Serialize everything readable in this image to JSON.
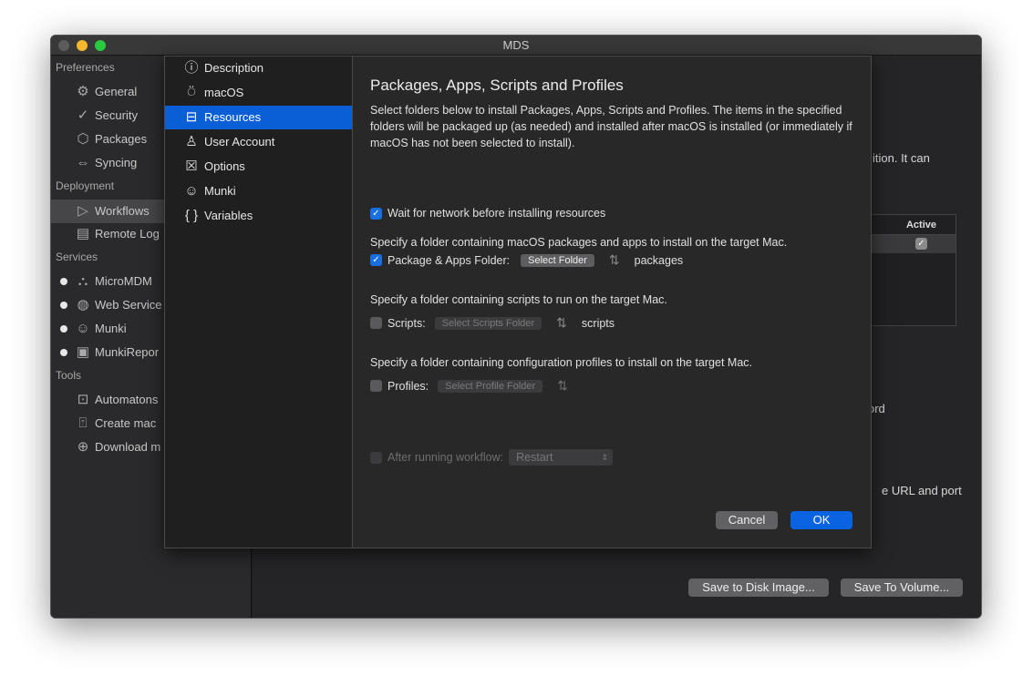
{
  "window": {
    "title": "MDS"
  },
  "sidebar": {
    "sections": [
      {
        "label": "Preferences",
        "items": [
          {
            "label": "General",
            "icon": "gear-icon"
          },
          {
            "label": "Security",
            "icon": "shield-check-icon"
          },
          {
            "label": "Packages",
            "icon": "package-icon"
          },
          {
            "label": "Syncing",
            "icon": "sync-icon"
          }
        ]
      },
      {
        "label": "Deployment",
        "items": [
          {
            "label": "Workflows",
            "icon": "play-icon",
            "selected": true
          },
          {
            "label": "Remote Log",
            "icon": "chat-icon"
          }
        ]
      },
      {
        "label": "Services",
        "items": [
          {
            "label": "MicroMDM",
            "icon": "micromdm-icon"
          },
          {
            "label": "Web Service",
            "icon": "globe-icon"
          },
          {
            "label": "Munki",
            "icon": "munki-icon"
          },
          {
            "label": "MunkiRepor",
            "icon": "munkireport-icon"
          }
        ]
      },
      {
        "label": "Tools",
        "items": [
          {
            "label": "Automatons",
            "icon": "robot-icon"
          },
          {
            "label": "Create mac",
            "icon": "upload-disk-icon"
          },
          {
            "label": "Download m",
            "icon": "download-icon"
          }
        ]
      }
    ]
  },
  "background": {
    "text1": "ition. It can",
    "active_header": "Active",
    "text2": "ord",
    "text3": "e URL and port",
    "save_disk": "Save to Disk Image...",
    "save_volume": "Save To Volume..."
  },
  "sheet": {
    "nav": [
      {
        "label": "Description",
        "icon": "info-icon"
      },
      {
        "label": "macOS",
        "icon": "macos-install-icon"
      },
      {
        "label": "Resources",
        "icon": "briefcase-icon",
        "selected": true
      },
      {
        "label": "User Account",
        "icon": "user-icon"
      },
      {
        "label": "Options",
        "icon": "options-x-icon"
      },
      {
        "label": "Munki",
        "icon": "munki-icon"
      },
      {
        "label": "Variables",
        "icon": "braces-icon"
      }
    ],
    "title": "Packages, Apps, Scripts and Profiles",
    "description": "Select folders below to install Packages, Apps, Scripts and Profiles. The items in the specified folders will be packaged up (as needed) and installed after macOS is installed (or immediately if macOS has not been selected to install).",
    "wait_network": {
      "label": "Wait for network before installing resources",
      "checked": true
    },
    "packages": {
      "hint": "Specify a folder containing macOS packages and apps to install on the target Mac.",
      "label": "Package & Apps Folder:",
      "button": "Select Folder",
      "value": "packages",
      "checked": true
    },
    "scripts": {
      "hint": "Specify a folder containing scripts to run on the target Mac.",
      "label": "Scripts:",
      "button": "Select Scripts Folder",
      "value": "scripts",
      "checked": false
    },
    "profiles": {
      "hint": "Specify a folder containing configuration profiles to install on the target Mac.",
      "label": "Profiles:",
      "button": "Select Profile Folder",
      "checked": false
    },
    "after": {
      "label": "After running workflow:",
      "value": "Restart",
      "checked": false
    },
    "cancel": "Cancel",
    "ok": "OK"
  },
  "colors": {
    "accent": "#0a63e0",
    "selected_nav": "#0a5fd6"
  }
}
